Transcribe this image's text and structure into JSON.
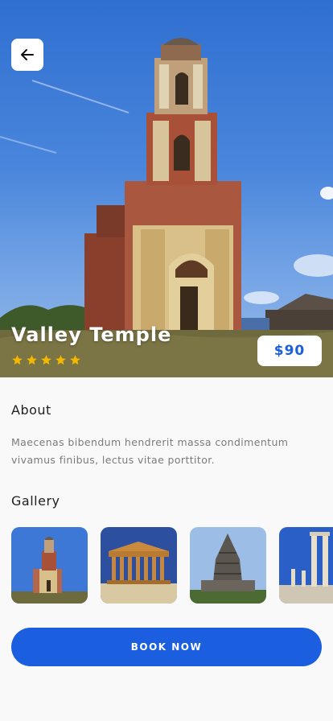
{
  "place": {
    "title": "Valley Temple",
    "rating": 5,
    "rating_max": 5,
    "price": "$90"
  },
  "about": {
    "heading": "About",
    "text": "Maecenas bibendum  hendrerit massa condimentum vivamus finibus, lectus vitae porttitor."
  },
  "gallery": {
    "heading": "Gallery",
    "images": [
      "bell-tower-image",
      "greek-temple-image",
      "hindu-temple-image",
      "roman-columns-image"
    ]
  },
  "actions": {
    "back_icon": "arrow-left-icon",
    "book_label": "BOOK NOW"
  },
  "colors": {
    "accent": "#1b5fe0",
    "star": "#f5b800",
    "background": "#f9f9f9"
  }
}
